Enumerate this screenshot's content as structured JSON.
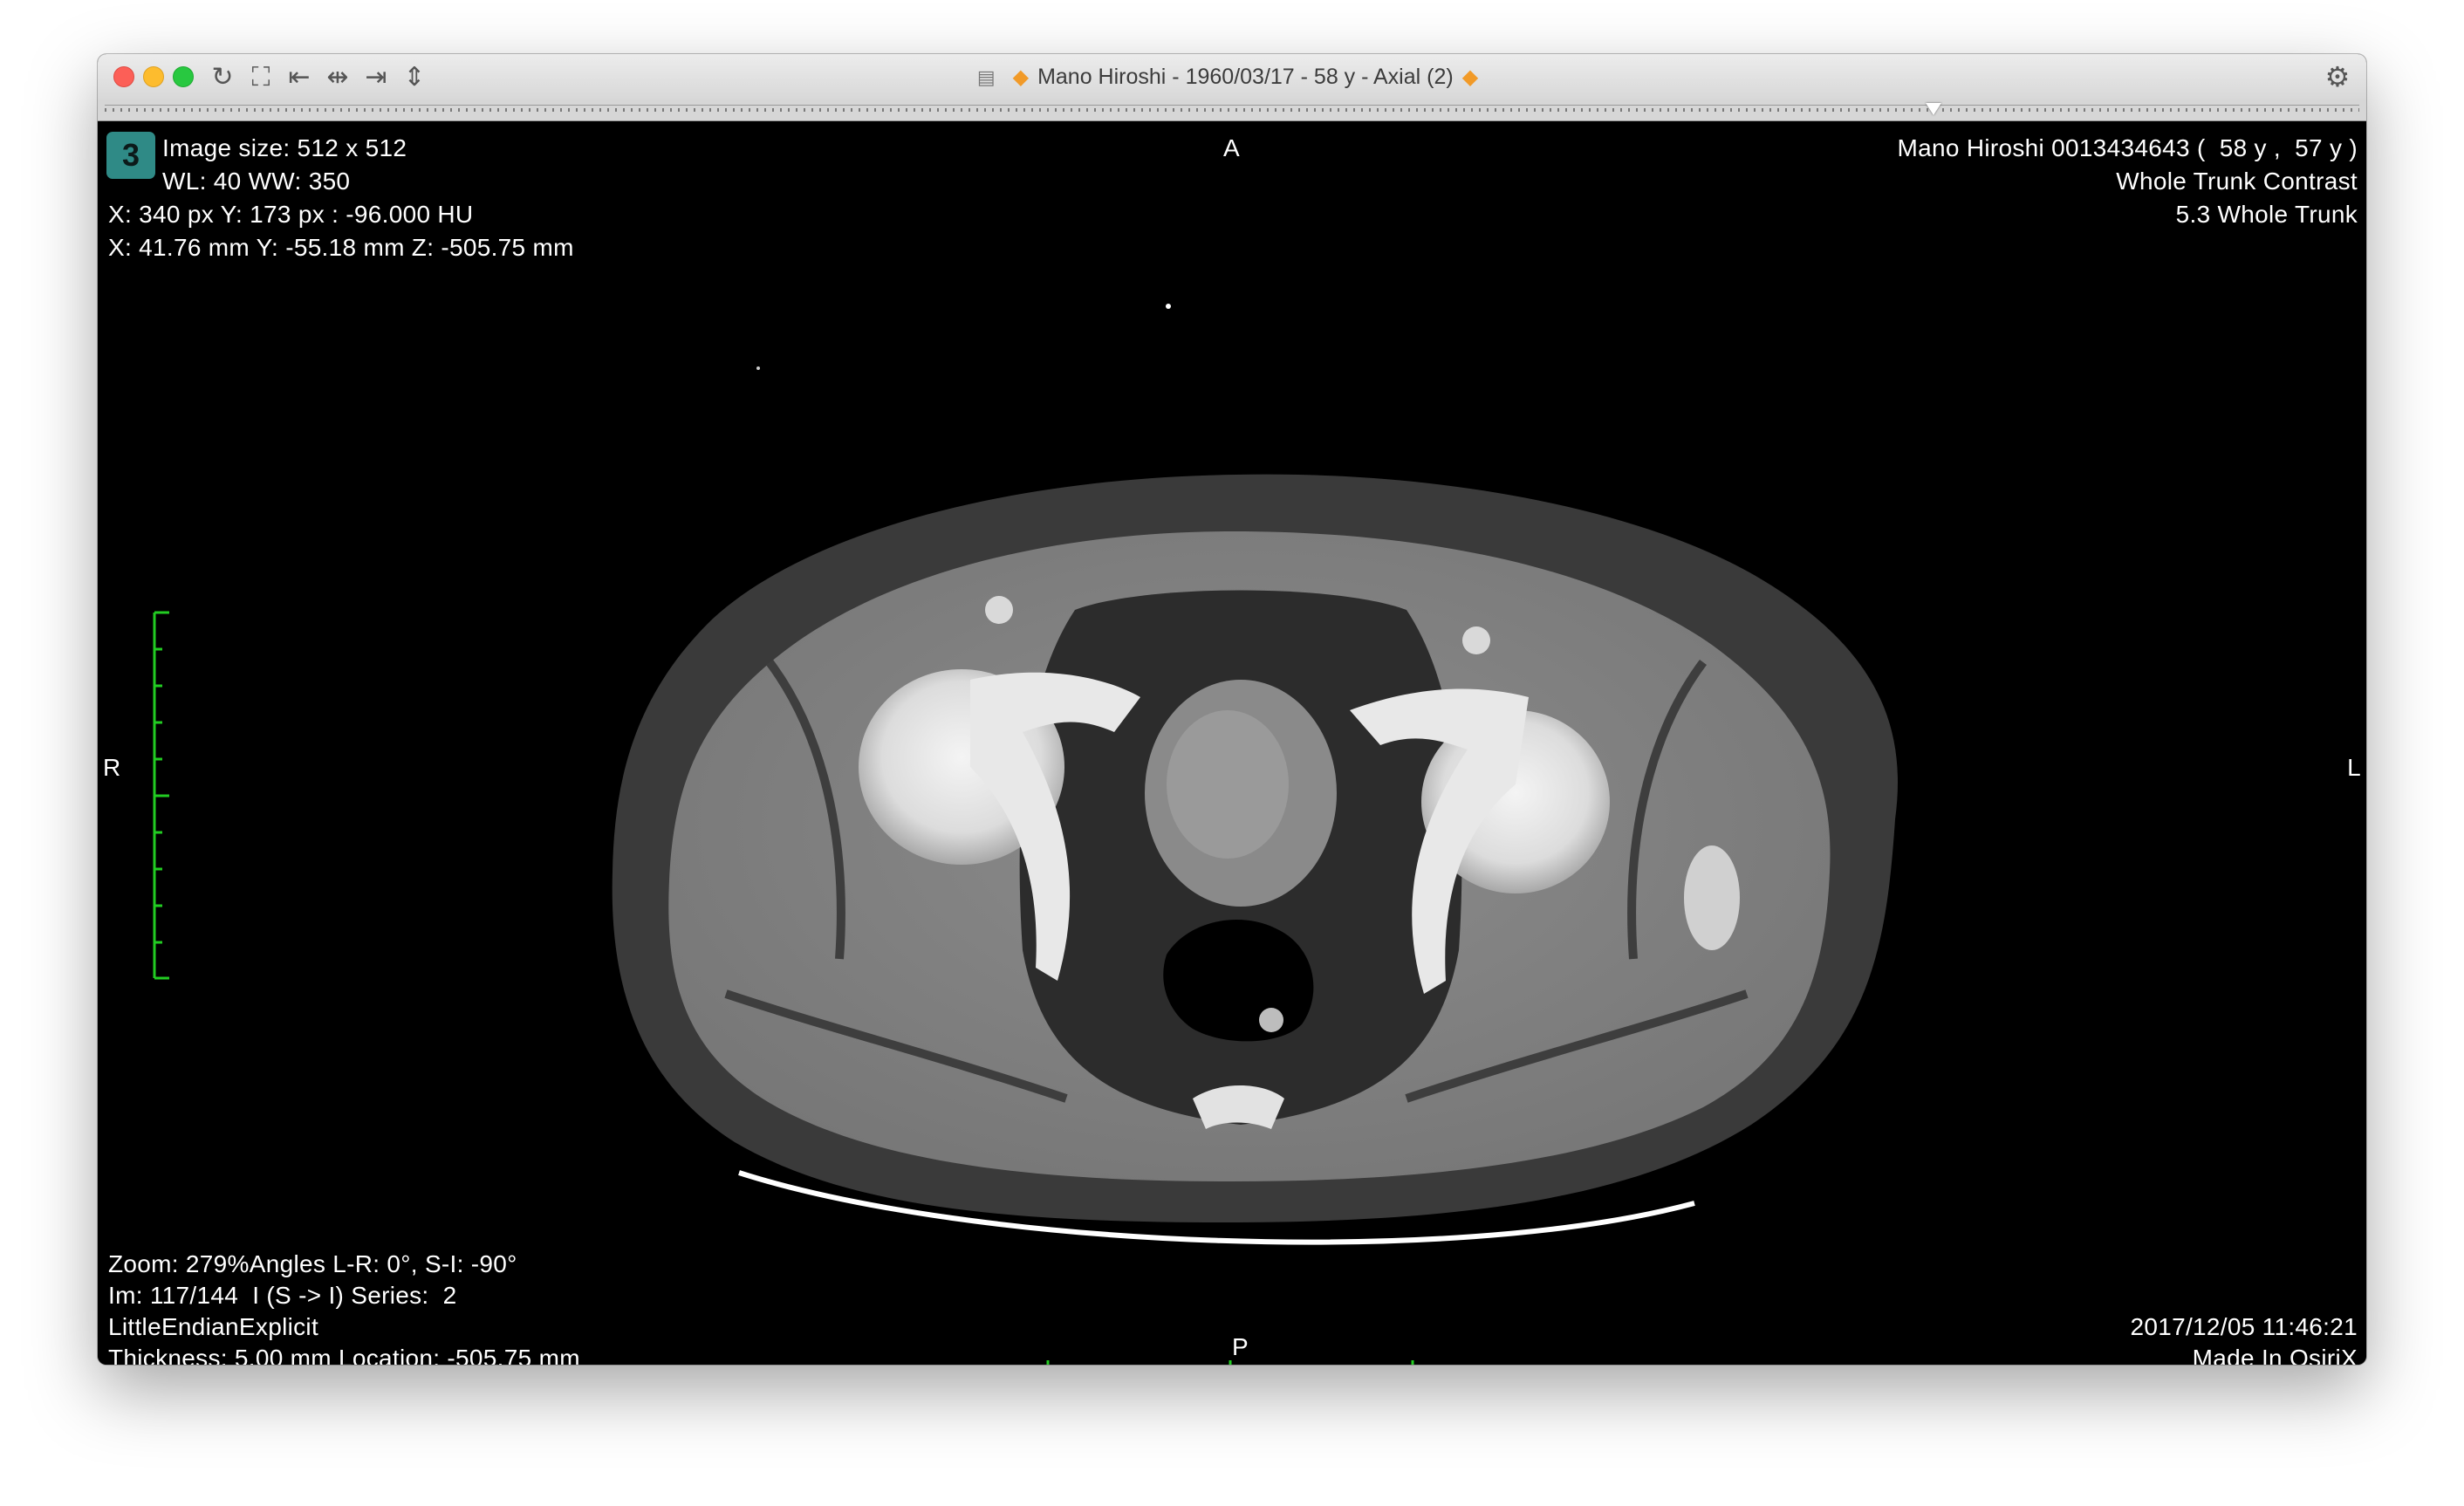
{
  "window": {
    "title": "Mano Hiroshi - 1960/03/17 - 58 y - Axial (2)",
    "title_icon": "dicom-file-icon",
    "title_badge_icon": "orange-diamond-icon",
    "toolbar_icons": [
      "rotate-reset-icon",
      "fullscreen-icon",
      "go-first-icon",
      "center-icon",
      "go-last-icon",
      "stack-icon"
    ],
    "settings_icon": "gear-icon"
  },
  "slider": {
    "current_image": 117,
    "total_images": 144
  },
  "overlay": {
    "series_number": "3",
    "top_left": [
      "Image size: 512 x 512",
      "WL: 40 WW: 350",
      "X: 340 px Y: 173 px : -96.000 HU",
      "X: 41.76 mm Y: -55.18 mm Z: -505.75 mm"
    ],
    "top_right": [
      "Mano Hiroshi 0013434643 (  58 y ,  57 y )",
      "Whole Trunk Contrast",
      "5.3 Whole Trunk"
    ],
    "bottom_left": [
      "Zoom: 279%Angles L-R: 0°, S-I: -90°",
      "Im: 117/144  I (S -> I) Series:  2",
      "LittleEndianExplicit",
      "Thickness: 5.00 mm Location: -505.75 mm"
    ],
    "bottom_right": [
      "2017/12/05 11:46:21",
      "Made In OsiriX"
    ],
    "orientation": {
      "top": "A",
      "bottom": "P",
      "left": "R",
      "right": "L"
    }
  },
  "colors": {
    "scale_bar": "#22cc22",
    "series_badge": "#2f8a86",
    "title_diamond": "#f19a28",
    "overlay_text": "#ffffff"
  }
}
